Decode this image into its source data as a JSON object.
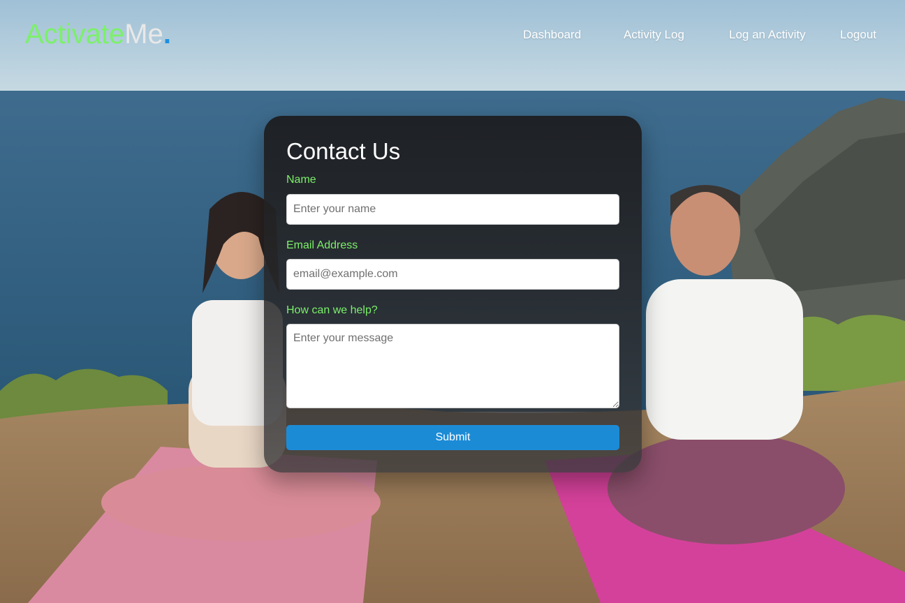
{
  "brand": {
    "part1": "Activate",
    "part2": "Me",
    "part3": "."
  },
  "nav": {
    "dashboard": "Dashboard",
    "activity_log": "Activity Log",
    "log_activity": "Log an Activity",
    "logout": "Logout"
  },
  "form": {
    "title": "Contact Us",
    "name_label": "Name",
    "name_placeholder": "Enter your name",
    "email_label": "Email Address",
    "email_placeholder": "email@example.com",
    "message_label": "How can we help?",
    "message_placeholder": "Enter your message",
    "submit_label": "Submit"
  },
  "colors": {
    "brand_green": "#7cf06a",
    "brand_gray": "#e8e8e8",
    "brand_blue": "#1d8fe0",
    "label_green": "#7cf06a",
    "submit_blue": "#1c8bd6",
    "card_dark": "#232325"
  },
  "background": {
    "description_icon": "yoga-photo",
    "people": [
      "woman-meditating",
      "man-meditating"
    ]
  }
}
